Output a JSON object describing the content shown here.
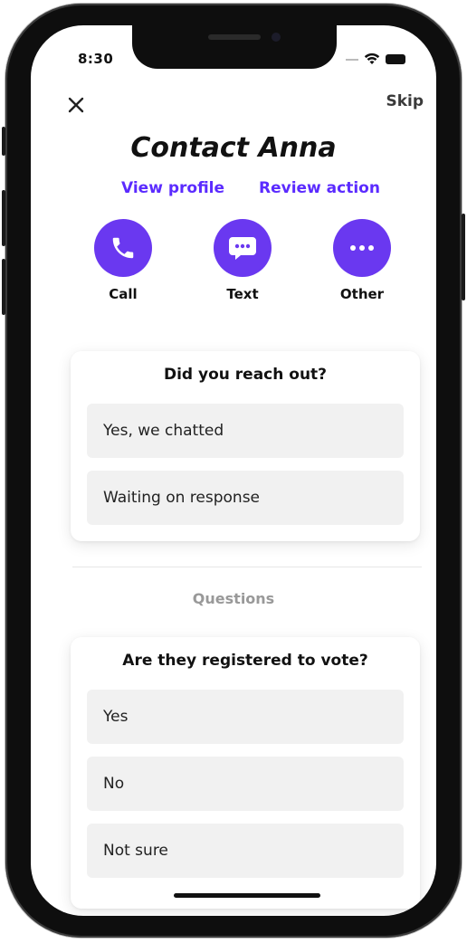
{
  "status_bar": {
    "time": "8:30"
  },
  "header": {
    "close_icon": "close-icon",
    "skip_label": "Skip",
    "title": "Contact Anna"
  },
  "links": {
    "view_profile": "View profile",
    "review_action": "Review action"
  },
  "actions": [
    {
      "label": "Call",
      "icon": "phone-icon"
    },
    {
      "label": "Text",
      "icon": "chat-bubble-icon"
    },
    {
      "label": "Other",
      "icon": "more-icon"
    }
  ],
  "reach_out": {
    "title": "Did you reach out?",
    "options": [
      "Yes, we chatted",
      "Waiting on response"
    ]
  },
  "questions_section": {
    "label": "Questions"
  },
  "registered": {
    "title": "Are they registered to vote?",
    "options": [
      "Yes",
      "No",
      "Not sure"
    ]
  },
  "colors": {
    "accent": "#6a38f0",
    "link": "#5b2bff",
    "option_bg": "#f1f1f1",
    "section_label": "#999999"
  }
}
